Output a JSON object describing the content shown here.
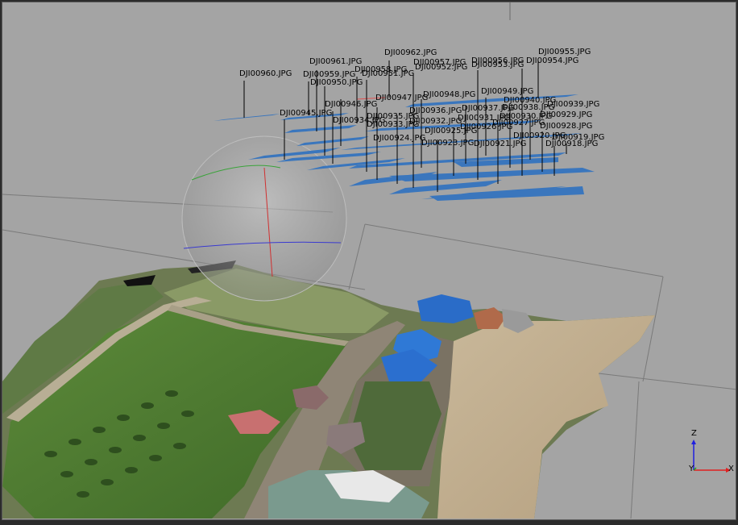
{
  "view": {
    "name": "3d-model-view"
  },
  "cameras": [
    "DJI00962.JPG",
    "DJI00955.JPG",
    "DJI00961.JPG",
    "DJI00957.JPG",
    "DJI00956.JPG",
    "DJI00954.JPG",
    "DJI00952.JPG",
    "DJI00953.JPG",
    "DJI00960.JPG",
    "DJI00958.JPG",
    "DJI00959.JPG",
    "DJI00951.JPG",
    "DJI00950.JPG",
    "DJI00948.JPG",
    "DJI00949.JPG",
    "DJI00947.JPG",
    "DJI00946.JPG",
    "DJI00940.JPG",
    "DJI00939.JPG",
    "DJI00945.JPG",
    "DJI00937.JPG",
    "DJI00938.JPG",
    "DJI00936.JPG",
    "DJI00935.JPG",
    "DJI00931.JPG",
    "DJI00930.JPG",
    "DJI00929.JPG",
    "DJI00934.JPG",
    "DJI00932.JPG",
    "DJI00933.JPG",
    "DJI00928.JPG",
    "DJI00926.JPG",
    "DJI00927.JPG",
    "DJI00925.JPG",
    "DJI00919.JPG",
    "DJI00920.JPG",
    "DJI00918.JPG",
    "DJI00924.JPG",
    "DJI00923.JPG",
    "DJI00921.JPG"
  ],
  "axes": {
    "z": "Z",
    "y": "Y",
    "x": "X"
  },
  "colors": {
    "background": "#a4a4a4",
    "camera_plane": "#3a76bd",
    "axis_x": "#e02020",
    "axis_y": "#20a020",
    "axis_z": "#2020e0"
  }
}
